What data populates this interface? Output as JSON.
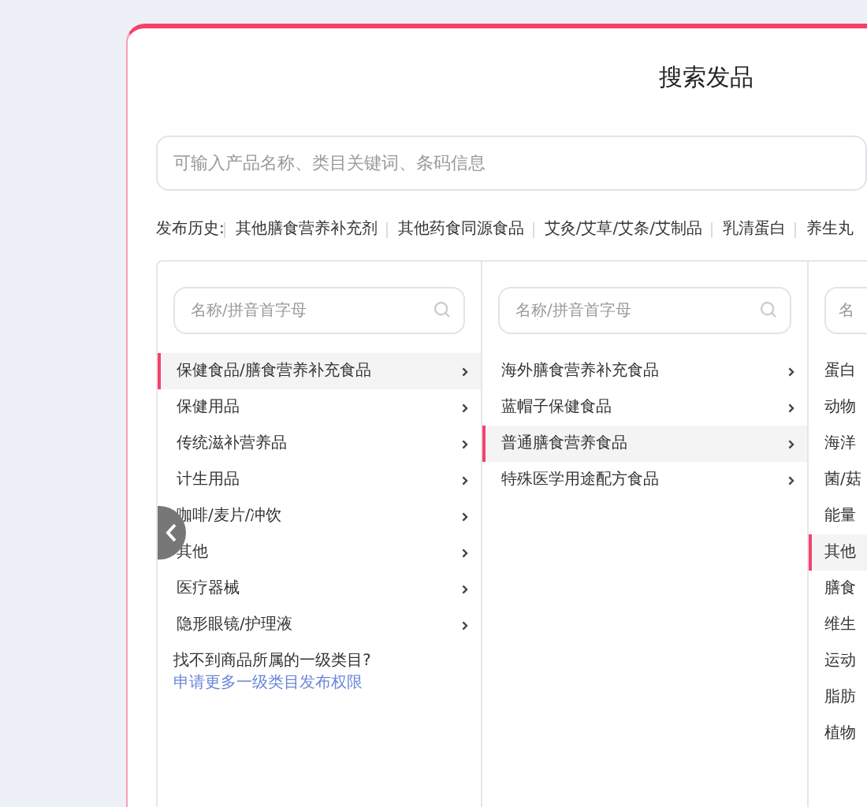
{
  "title": "搜索发品",
  "search": {
    "placeholder": "可输入产品名称、类目关键词、条码信息"
  },
  "history": {
    "label": "发布历史:",
    "items": [
      "其他膳食营养补充剂",
      "其他药食同源食品",
      "艾灸/艾草/艾条/艾制品",
      "乳清蛋白",
      "养生丸"
    ]
  },
  "columns": [
    {
      "search_placeholder": "名称/拼音首字母",
      "items": [
        {
          "label": "保健食品/膳食营养补充食品",
          "selected": true
        },
        {
          "label": "保健用品",
          "selected": false
        },
        {
          "label": "传统滋补营养品",
          "selected": false
        },
        {
          "label": "计生用品",
          "selected": false
        },
        {
          "label": "咖啡/麦片/冲饮",
          "selected": false
        },
        {
          "label": "其他",
          "selected": false
        },
        {
          "label": "医疗器械",
          "selected": false
        },
        {
          "label": "隐形眼镜/护理液",
          "selected": false
        }
      ],
      "footer": {
        "text": "找不到商品所属的一级类目?",
        "link": "申请更多一级类目发布权限"
      }
    },
    {
      "search_placeholder": "名称/拼音首字母",
      "items": [
        {
          "label": "海外膳食营养补充食品",
          "selected": false
        },
        {
          "label": "蓝帽子保健食品",
          "selected": false
        },
        {
          "label": "普通膳食营养食品",
          "selected": true
        },
        {
          "label": "特殊医学用途配方食品",
          "selected": false
        }
      ]
    },
    {
      "search_placeholder": "名",
      "items": [
        {
          "label": "蛋白",
          "selected": false
        },
        {
          "label": "动物",
          "selected": false
        },
        {
          "label": "海洋",
          "selected": false
        },
        {
          "label": "菌/菇",
          "selected": false
        },
        {
          "label": "能量",
          "selected": false
        },
        {
          "label": "其他",
          "selected": true
        },
        {
          "label": "膳食",
          "selected": false
        },
        {
          "label": "维生",
          "selected": false
        },
        {
          "label": "运动",
          "selected": false
        },
        {
          "label": "脂肪",
          "selected": false
        },
        {
          "label": "植物",
          "selected": false
        }
      ]
    }
  ]
}
